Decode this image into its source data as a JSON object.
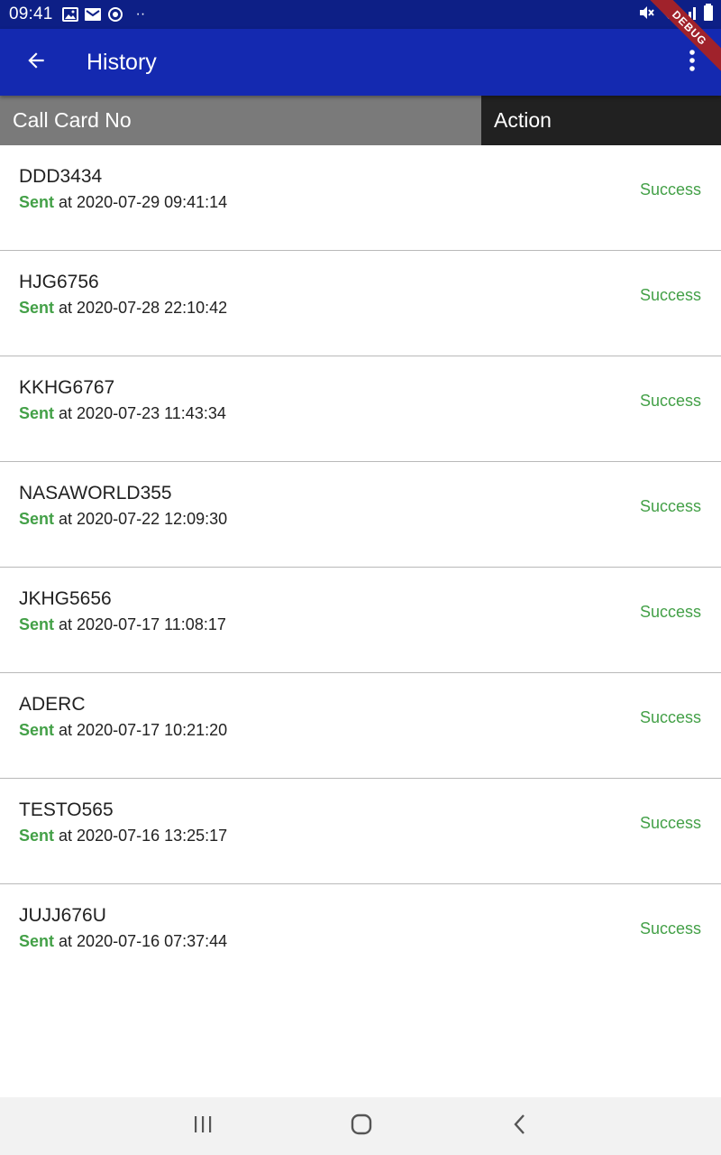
{
  "status_bar": {
    "time": "09:41",
    "dots": "··",
    "icons_left": [
      "image-icon",
      "mail-icon",
      "sync-icon"
    ],
    "icons_right": [
      "mute-icon",
      "wifi-icon",
      "signal-icon",
      "battery-icon"
    ],
    "background": "#0d1f86"
  },
  "app_bar": {
    "title": "History",
    "debug_banner": "DEBUG",
    "background": "#1429b0",
    "back_icon": "arrow-back-icon",
    "menu_icon": "more-vert-icon"
  },
  "table_header": {
    "card_no": "Call Card No",
    "action": "Action"
  },
  "rows": [
    {
      "card_no": "DDD3434",
      "sent_label": "Sent",
      "sent_text": "at 2020-07-29 09:41:14",
      "status": "Success"
    },
    {
      "card_no": "HJG6756",
      "sent_label": "Sent",
      "sent_text": "at 2020-07-28 22:10:42",
      "status": "Success"
    },
    {
      "card_no": "KKHG6767",
      "sent_label": "Sent",
      "sent_text": "at 2020-07-23 11:43:34",
      "status": "Success"
    },
    {
      "card_no": "NASAWORLD355",
      "sent_label": "Sent",
      "sent_text": "at 2020-07-22 12:09:30",
      "status": "Success"
    },
    {
      "card_no": "JKHG5656",
      "sent_label": "Sent",
      "sent_text": "at 2020-07-17 11:08:17",
      "status": "Success"
    },
    {
      "card_no": "ADERC",
      "sent_label": "Sent",
      "sent_text": "at 2020-07-17 10:21:20",
      "status": "Success"
    },
    {
      "card_no": "TESTO565",
      "sent_label": "Sent",
      "sent_text": "at 2020-07-16 13:25:17",
      "status": "Success"
    },
    {
      "card_no": "JUJJ676U",
      "sent_label": "Sent",
      "sent_text": "at 2020-07-16 07:37:44",
      "status": "Success"
    }
  ],
  "colors": {
    "success": "#43a047",
    "header_left": "#7a7a7a",
    "header_right": "#212121"
  },
  "nav_bar": {
    "icons": [
      "recents-icon",
      "home-icon",
      "back-icon"
    ]
  }
}
